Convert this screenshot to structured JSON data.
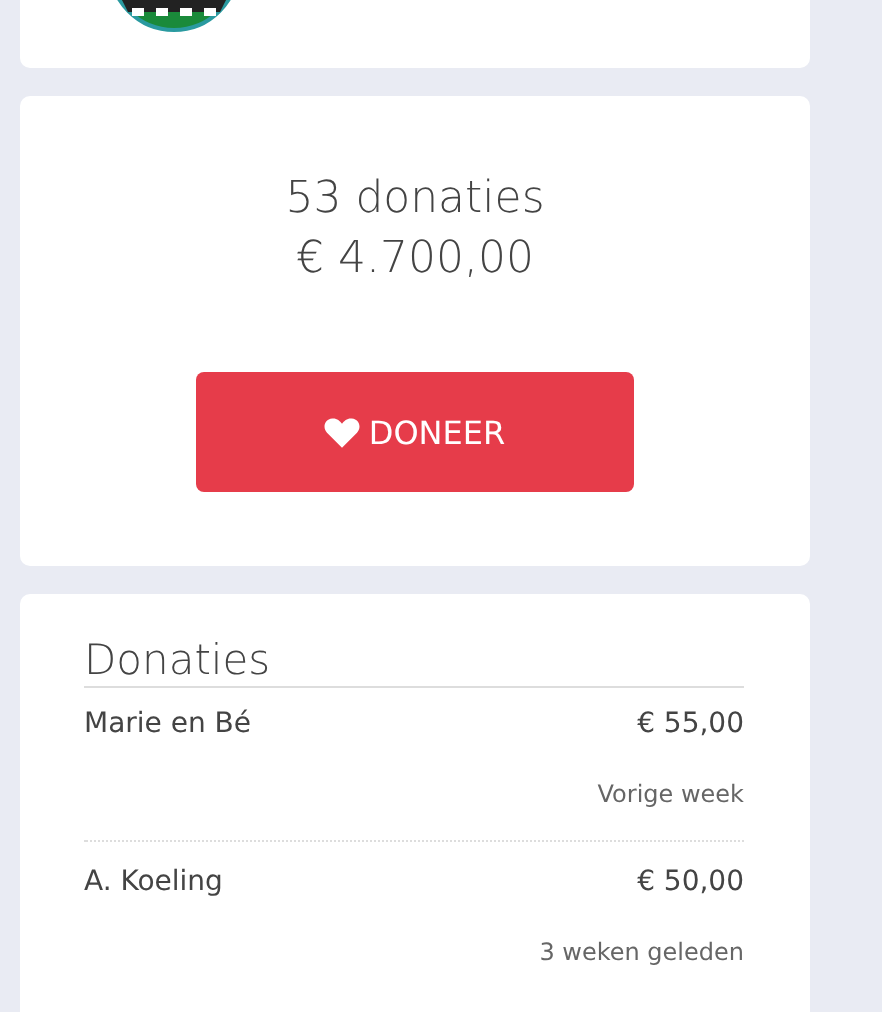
{
  "summary": {
    "count": "53 donaties",
    "total": "€ 4.700,00",
    "button": "DONEER"
  },
  "donations": {
    "title": "Donaties",
    "items": [
      {
        "name": "Marie en Bé",
        "amount": "€ 55,00",
        "time": "Vorige week"
      },
      {
        "name": "A. Koeling",
        "amount": "€ 50,00",
        "time": "3 weken geleden"
      }
    ]
  }
}
